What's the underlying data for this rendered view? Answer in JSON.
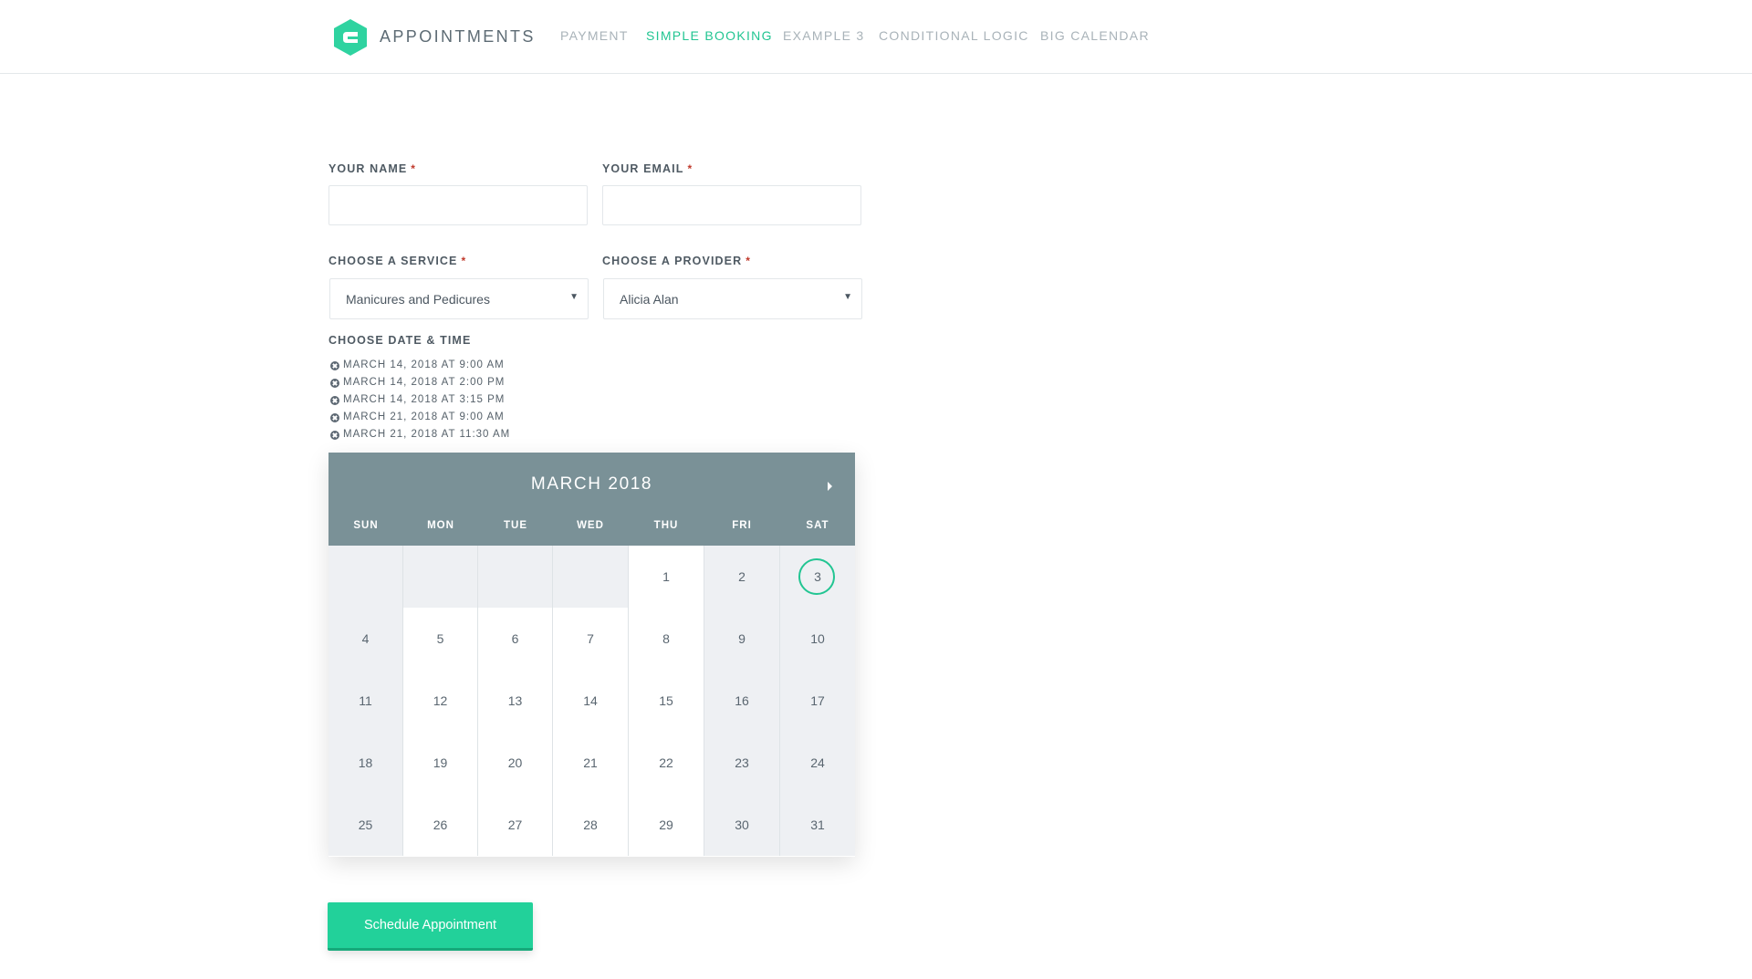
{
  "header": {
    "brand": "APPOINTMENTS",
    "nav": [
      {
        "label": "PAYMENT",
        "active": false
      },
      {
        "label": "SIMPLE BOOKING",
        "active": true
      },
      {
        "label": "EXAMPLE 3",
        "active": false
      },
      {
        "label": "CONDITIONAL LOGIC",
        "active": false
      },
      {
        "label": "BIG CALENDAR",
        "active": false
      }
    ]
  },
  "form": {
    "name_label": "YOUR NAME",
    "email_label": "YOUR EMAIL",
    "service_label": "CHOOSE A SERVICE",
    "provider_label": "CHOOSE A PROVIDER",
    "required_mark": "*",
    "service_value": "Manicures and Pedicures",
    "provider_value": "Alicia Alan",
    "datetime_label": "CHOOSE DATE & TIME",
    "selected_slots": [
      "MARCH 14, 2018 AT 9:00 AM",
      "MARCH 14, 2018 AT 2:00 PM",
      "MARCH 14, 2018 AT 3:15 PM",
      "MARCH 21, 2018 AT 9:00 AM",
      "MARCH 21, 2018 AT 11:30 AM"
    ],
    "submit_label": "Schedule Appointment"
  },
  "calendar": {
    "title": "MARCH 2018",
    "weekdays": [
      "SUN",
      "MON",
      "TUE",
      "WED",
      "THU",
      "FRI",
      "SAT"
    ],
    "selected_day": "3",
    "weeks": [
      [
        "",
        "",
        "",
        "",
        "1",
        "2",
        "3"
      ],
      [
        "4",
        "5",
        "6",
        "7",
        "8",
        "9",
        "10"
      ],
      [
        "11",
        "12",
        "13",
        "14",
        "15",
        "16",
        "17"
      ],
      [
        "18",
        "19",
        "20",
        "21",
        "22",
        "23",
        "24"
      ],
      [
        "25",
        "26",
        "27",
        "28",
        "29",
        "30",
        "31"
      ]
    ],
    "colors": {
      "header": "#7a9197",
      "accent": "#22c592",
      "unavailable": "#eef0f3"
    }
  }
}
